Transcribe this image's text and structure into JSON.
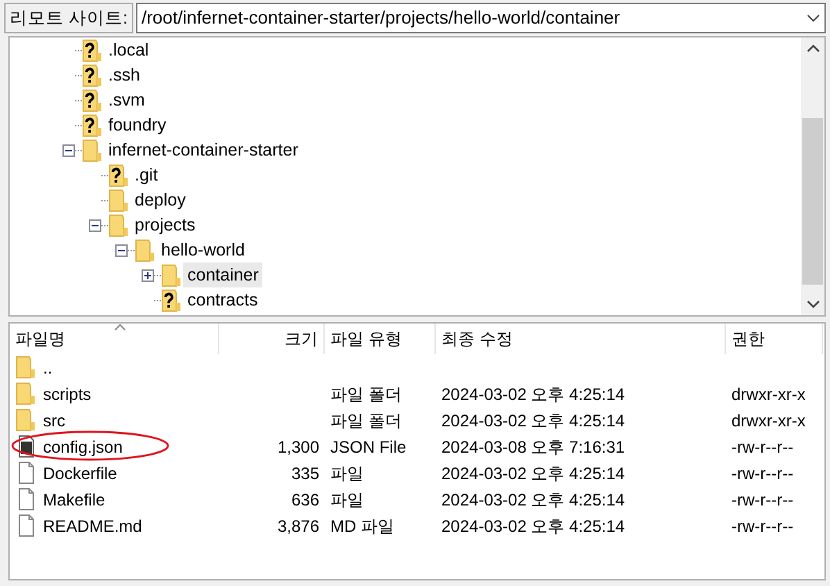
{
  "path_bar": {
    "label": "리모트 사이트:",
    "value": "/root/infernet-container-starter/projects/hello-world/container"
  },
  "tree": [
    {
      "label": ".local",
      "kind": "unknown"
    },
    {
      "label": ".ssh",
      "kind": "unknown"
    },
    {
      "label": ".svm",
      "kind": "unknown"
    },
    {
      "label": "foundry",
      "kind": "unknown"
    },
    {
      "label": "infernet-container-starter",
      "kind": "folder",
      "expanded": true,
      "children": [
        {
          "label": ".git",
          "kind": "unknown"
        },
        {
          "label": "deploy",
          "kind": "folder"
        },
        {
          "label": "projects",
          "kind": "folder",
          "expanded": true,
          "children": [
            {
              "label": "hello-world",
              "kind": "folder",
              "expanded": true,
              "children": [
                {
                  "label": "container",
                  "kind": "folder",
                  "expanded": false,
                  "selected": true
                },
                {
                  "label": "contracts",
                  "kind": "unknown"
                }
              ]
            }
          ]
        }
      ]
    }
  ],
  "file_list": {
    "columns": [
      "파일명",
      "크기",
      "파일 유형",
      "최종 수정",
      "권한"
    ],
    "rows": [
      {
        "kind": "folder",
        "name": "..",
        "size": "",
        "type": "",
        "modified": "",
        "perms": "",
        "circled": false
      },
      {
        "kind": "folder",
        "name": "scripts",
        "size": "",
        "type": "파일 폴더",
        "modified": "2024-03-02 오후 4:25:14",
        "perms": "drwxr-xr-x",
        "circled": false
      },
      {
        "kind": "folder",
        "name": "src",
        "size": "",
        "type": "파일 폴더",
        "modified": "2024-03-02 오후 4:25:14",
        "perms": "drwxr-xr-x",
        "circled": false
      },
      {
        "kind": "json",
        "name": "config.json",
        "size": "1,300",
        "type": "JSON File",
        "modified": "2024-03-08 오후 7:16:31",
        "perms": "-rw-r--r--",
        "circled": true
      },
      {
        "kind": "file",
        "name": "Dockerfile",
        "size": "335",
        "type": "파일",
        "modified": "2024-03-02 오후 4:25:14",
        "perms": "-rw-r--r--",
        "circled": false
      },
      {
        "kind": "file",
        "name": "Makefile",
        "size": "636",
        "type": "파일",
        "modified": "2024-03-02 오후 4:25:14",
        "perms": "-rw-r--r--",
        "circled": false
      },
      {
        "kind": "file",
        "name": "README.md",
        "size": "3,876",
        "type": "MD 파일",
        "modified": "2024-03-02 오후 4:25:14",
        "perms": "-rw-r--r--",
        "circled": false
      }
    ]
  }
}
